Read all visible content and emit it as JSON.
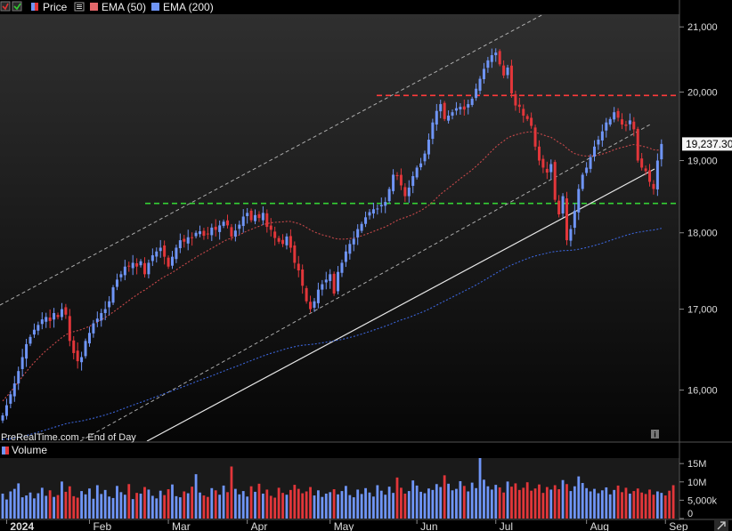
{
  "legend": {
    "price_label": "Price",
    "ema50_label": "EMA (50)",
    "ema200_label": "EMA (200)"
  },
  "watermark": "PreRealTime.com - End of Day",
  "volume_label": "Volume",
  "last_price_label": "19,237.30",
  "colors": {
    "background": "#000000",
    "up": "#6f95f7",
    "down": "#e2363a",
    "ema50": "#c8484a",
    "ema200": "#3b64d8",
    "resistance": "#ff3b3b",
    "support": "#35d335",
    "channel": "#cfcfcf",
    "trendline": "#e6e6e6",
    "axis_text": "#dddddd"
  },
  "chart_data": {
    "type": "candlestick",
    "title": "",
    "xlabel": "",
    "ylabel": "",
    "ylim": [
      15400,
      21200
    ],
    "y_scale": "log",
    "grid": false,
    "y_ticks": [
      {
        "value": 16000,
        "label": "16,000"
      },
      {
        "value": 17000,
        "label": "17,000"
      },
      {
        "value": 18000,
        "label": "18,000"
      },
      {
        "value": 19000,
        "label": "19,000"
      },
      {
        "value": 20000,
        "label": "20,000"
      },
      {
        "value": 21000,
        "label": "21,000"
      }
    ],
    "x_ticks": [
      "2024",
      "Feb",
      "Mar",
      "Apr",
      "May",
      "Jun",
      "Jul",
      "Aug",
      "Sep"
    ],
    "x_tick_day_index": [
      1,
      22,
      42,
      62,
      83,
      105,
      125,
      148,
      168
    ],
    "last_close": 19237.3,
    "close": [
      15700,
      15820,
      15950,
      16080,
      16230,
      16400,
      16560,
      16650,
      16740,
      16800,
      16870,
      16900,
      16850,
      16950,
      16900,
      17000,
      16930,
      16600,
      16450,
      16350,
      16400,
      16600,
      16700,
      16820,
      16880,
      16950,
      17000,
      17100,
      17280,
      17380,
      17450,
      17550,
      17560,
      17600,
      17550,
      17620,
      17450,
      17600,
      17700,
      17750,
      17800,
      17680,
      17550,
      17680,
      17800,
      17900,
      17880,
      17940,
      17930,
      18000,
      18020,
      17960,
      17980,
      18070,
      18040,
      18100,
      18150,
      18100,
      17950,
      18030,
      18110,
      18220,
      18270,
      18170,
      18240,
      18200,
      18270,
      18080,
      18040,
      17930,
      17880,
      17850,
      17950,
      17800,
      17600,
      17500,
      17300,
      17100,
      17000,
      17100,
      17250,
      17320,
      17380,
      17450,
      17200,
      17480,
      17600,
      17750,
      17850,
      17920,
      18050,
      18120,
      18210,
      18280,
      18320,
      18330,
      18380,
      18420,
      18600,
      18800,
      18780,
      18650,
      18500,
      18620,
      18780,
      18900,
      18960,
      19100,
      19300,
      19550,
      19720,
      19820,
      19600,
      19650,
      19700,
      19760,
      19780,
      19740,
      19820,
      19900,
      20050,
      20200,
      20350,
      20480,
      20560,
      20600,
      20420,
      20250,
      20370,
      19980,
      19800,
      19780,
      19650,
      19600,
      19500,
      19200,
      19000,
      18900,
      18830,
      18950,
      18450,
      18250,
      18500,
      17900,
      18050,
      18300,
      18600,
      18800,
      18900,
      19050,
      19200,
      19300,
      19420,
      19550,
      19600,
      19700,
      19620,
      19520,
      19500,
      19580,
      19450,
      19000,
      18900,
      18850,
      18700,
      18600,
      19000,
      19237.3
    ],
    "series": [
      {
        "name": "EMA (50)",
        "values": [
          15870,
          15923,
          15979,
          16037,
          16097,
          16162,
          16223,
          16281,
          16335,
          16386,
          16434,
          16480,
          16521,
          16563,
          16602,
          16642,
          16678,
          16700,
          16716,
          16729,
          16742,
          16762,
          16784,
          16809,
          16836,
          16865,
          16894,
          16926,
          16961,
          16998,
          17035,
          17073,
          17110,
          17147,
          17181,
          17217,
          17245,
          17279,
          17315,
          17351,
          17387,
          17418,
          17444,
          17474,
          17506,
          17542,
          17574,
          17608,
          17640,
          17673,
          17706,
          17734,
          17763,
          17794,
          17823,
          17853,
          17884,
          17911,
          17928,
          17949,
          17972,
          17999,
          18026,
          18046,
          18069,
          18088,
          18111,
          18124,
          18135,
          18141,
          18145,
          18148,
          18154,
          18153,
          18140,
          18125,
          18102,
          18072,
          18039,
          18012,
          17991,
          17973,
          17958,
          17946,
          17925,
          17917,
          17914,
          17917,
          17922,
          17930,
          17943,
          17959,
          17977,
          17998,
          18019,
          18039,
          18060,
          18081,
          18107,
          18139,
          18168,
          18191,
          18207,
          18227,
          18249,
          18276,
          18303,
          18335,
          18374,
          18422,
          18474,
          18528,
          18571,
          18614,
          18657,
          18701,
          18745,
          18785,
          18827,
          18870,
          18918,
          18970,
          19025,
          19082,
          19139,
          19195,
          19242,
          19281,
          19324,
          19351,
          19370,
          19387,
          19399,
          19409,
          19413,
          19405,
          19389,
          19370,
          19349,
          19333,
          19298,
          19258,
          19229,
          19177,
          19133,
          19100,
          19081,
          19070,
          19064,
          19065,
          19070,
          19079,
          19093,
          19111,
          19131,
          19154,
          19173,
          19188,
          19202,
          19219,
          19229,
          19221,
          19208,
          19195,
          19177,
          19155,
          19149,
          19153
        ]
      },
      {
        "name": "EMA (200)",
        "values": [
          15420,
          15424,
          15429,
          15436,
          15444,
          15454,
          15465,
          15478,
          15491,
          15504,
          15518,
          15532,
          15546,
          15560,
          15574,
          15588,
          15602,
          15612,
          15620,
          15627,
          15635,
          15645,
          15656,
          15667,
          15680,
          15692,
          15706,
          15720,
          15735,
          15752,
          15769,
          15786,
          15804,
          15821,
          15838,
          15855,
          15871,
          15888,
          15906,
          15924,
          15942,
          15959,
          15975,
          15991,
          16009,
          16027,
          16045,
          16063,
          16081,
          16100,
          16119,
          16136,
          16154,
          16173,
          16191,
          16210,
          16229,
          16248,
          16265,
          16283,
          16301,
          16320,
          16340,
          16358,
          16377,
          16395,
          16414,
          16431,
          16447,
          16462,
          16476,
          16490,
          16505,
          16518,
          16529,
          16539,
          16546,
          16552,
          16556,
          16562,
          16569,
          16577,
          16585,
          16594,
          16600,
          16609,
          16619,
          16631,
          16643,
          16656,
          16671,
          16686,
          16702,
          16718,
          16735,
          16751,
          16768,
          16785,
          16803,
          16824,
          16844,
          16863,
          16879,
          16896,
          16915,
          16935,
          16955,
          16976,
          16999,
          17024,
          17051,
          17078,
          17103,
          17128,
          17154,
          17180,
          17206,
          17231,
          17257,
          17283,
          17310,
          17339,
          17369,
          17400,
          17431,
          17462,
          17491,
          17518,
          17547,
          17571,
          17593,
          17615,
          17636,
          17656,
          17675,
          17690,
          17704,
          17716,
          17728,
          17742,
          17749,
          17754,
          17762,
          17763,
          17766,
          17772,
          17780,
          17791,
          17802,
          17815,
          17830,
          17845,
          17861,
          17879,
          17896,
          17915,
          17932,
          17949,
          17965,
          17981,
          17996,
          18006,
          18015,
          18024,
          18032,
          18038,
          18048,
          18060
        ]
      }
    ],
    "volume": {
      "name": "Volume",
      "ylim_millions": [
        0,
        16.5
      ],
      "y_ticks": [
        {
          "value": 0,
          "label": "0"
        },
        {
          "value": 5,
          "label": "5,000k"
        },
        {
          "value": 10,
          "label": "10M"
        },
        {
          "value": 15,
          "label": "15M"
        }
      ],
      "values_millions": [
        6.8,
        5.2,
        7.4,
        8.1,
        9.6,
        5.8,
        6.3,
        7.1,
        5.5,
        6.9,
        8.4,
        6.2,
        7.7,
        5.9,
        6.4,
        10.1,
        7.3,
        8.8,
        6.1,
        5.7,
        7.5,
        6.6,
        8.2,
        5.4,
        9.1,
        6.7,
        7.8,
        6.0,
        5.6,
        8.9,
        7.2,
        6.5,
        9.4,
        5.3,
        7.0,
        6.8,
        8.6,
        7.9,
        6.2,
        5.5,
        7.6,
        6.4,
        8.0,
        9.3,
        6.1,
        5.8,
        7.4,
        6.9,
        8.7,
        12.1,
        7.1,
        6.3,
        5.9,
        8.3,
        7.7,
        6.5,
        9.0,
        7.2,
        14.2,
        8.1,
        6.6,
        7.5,
        6.0,
        8.8,
        7.3,
        9.5,
        6.8,
        7.9,
        6.2,
        5.7,
        8.4,
        7.0,
        6.5,
        7.8,
        9.2,
        8.1,
        6.9,
        7.4,
        8.6,
        6.3,
        7.7,
        5.9,
        6.8,
        7.2,
        8.0,
        6.6,
        7.5,
        8.9,
        6.4,
        5.8,
        7.9,
        6.7,
        8.3,
        7.1,
        6.0,
        9.1,
        7.6,
        6.5,
        8.7,
        7.0,
        11.2,
        8.4,
        6.8,
        7.5,
        10.4,
        9.0,
        7.3,
        6.9,
        8.2,
        7.8,
        9.4,
        8.6,
        11.8,
        9.5,
        7.7,
        8.1,
        10.2,
        8.9,
        7.4,
        9.8,
        8.3,
        17.5,
        10.6,
        8.8,
        7.9,
        9.2,
        8.5,
        7.1,
        10.1,
        8.7,
        9.6,
        7.8,
        8.4,
        9.9,
        7.6,
        8.2,
        9.3,
        7.0,
        8.6,
        7.9,
        9.1,
        8.0,
        10.5,
        9.4,
        7.5,
        8.8,
        11.5,
        9.7,
        8.3,
        7.4,
        8.1,
        6.9,
        7.7,
        8.5,
        6.6,
        7.8,
        9.0,
        7.2,
        8.4,
        6.8,
        7.5,
        8.2,
        7.1,
        6.7,
        7.9,
        6.5,
        7.4,
        7.0,
        6.3,
        7.6,
        9.1
      ]
    },
    "annotations": [
      {
        "type": "hline",
        "name": "resistance",
        "value": 19950,
        "style": "dashed"
      },
      {
        "type": "hline",
        "name": "support",
        "value": 18400,
        "style": "dashed"
      }
    ]
  }
}
